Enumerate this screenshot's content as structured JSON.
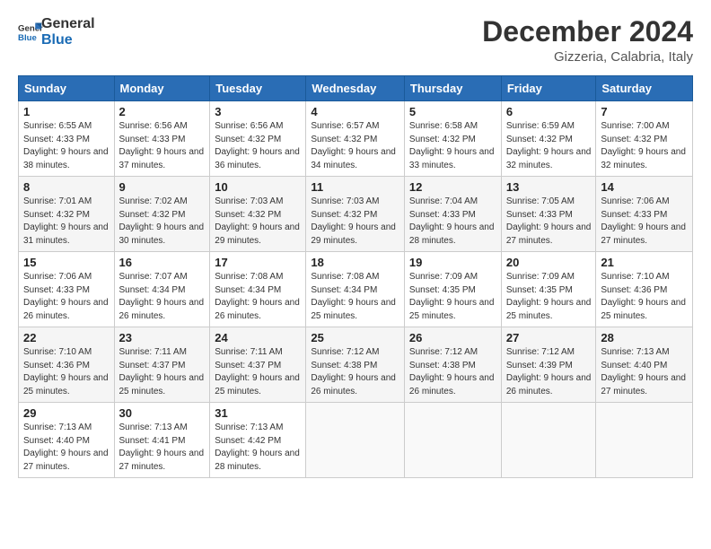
{
  "logo": {
    "line1": "General",
    "line2": "Blue"
  },
  "title": "December 2024",
  "location": "Gizzeria, Calabria, Italy",
  "days_of_week": [
    "Sunday",
    "Monday",
    "Tuesday",
    "Wednesday",
    "Thursday",
    "Friday",
    "Saturday"
  ],
  "weeks": [
    [
      {
        "day": "1",
        "sunrise": "6:55 AM",
        "sunset": "4:33 PM",
        "daylight": "9 hours and 38 minutes."
      },
      {
        "day": "2",
        "sunrise": "6:56 AM",
        "sunset": "4:33 PM",
        "daylight": "9 hours and 37 minutes."
      },
      {
        "day": "3",
        "sunrise": "6:56 AM",
        "sunset": "4:32 PM",
        "daylight": "9 hours and 36 minutes."
      },
      {
        "day": "4",
        "sunrise": "6:57 AM",
        "sunset": "4:32 PM",
        "daylight": "9 hours and 34 minutes."
      },
      {
        "day": "5",
        "sunrise": "6:58 AM",
        "sunset": "4:32 PM",
        "daylight": "9 hours and 33 minutes."
      },
      {
        "day": "6",
        "sunrise": "6:59 AM",
        "sunset": "4:32 PM",
        "daylight": "9 hours and 32 minutes."
      },
      {
        "day": "7",
        "sunrise": "7:00 AM",
        "sunset": "4:32 PM",
        "daylight": "9 hours and 32 minutes."
      }
    ],
    [
      {
        "day": "8",
        "sunrise": "7:01 AM",
        "sunset": "4:32 PM",
        "daylight": "9 hours and 31 minutes."
      },
      {
        "day": "9",
        "sunrise": "7:02 AM",
        "sunset": "4:32 PM",
        "daylight": "9 hours and 30 minutes."
      },
      {
        "day": "10",
        "sunrise": "7:03 AM",
        "sunset": "4:32 PM",
        "daylight": "9 hours and 29 minutes."
      },
      {
        "day": "11",
        "sunrise": "7:03 AM",
        "sunset": "4:32 PM",
        "daylight": "9 hours and 29 minutes."
      },
      {
        "day": "12",
        "sunrise": "7:04 AM",
        "sunset": "4:33 PM",
        "daylight": "9 hours and 28 minutes."
      },
      {
        "day": "13",
        "sunrise": "7:05 AM",
        "sunset": "4:33 PM",
        "daylight": "9 hours and 27 minutes."
      },
      {
        "day": "14",
        "sunrise": "7:06 AM",
        "sunset": "4:33 PM",
        "daylight": "9 hours and 27 minutes."
      }
    ],
    [
      {
        "day": "15",
        "sunrise": "7:06 AM",
        "sunset": "4:33 PM",
        "daylight": "9 hours and 26 minutes."
      },
      {
        "day": "16",
        "sunrise": "7:07 AM",
        "sunset": "4:34 PM",
        "daylight": "9 hours and 26 minutes."
      },
      {
        "day": "17",
        "sunrise": "7:08 AM",
        "sunset": "4:34 PM",
        "daylight": "9 hours and 26 minutes."
      },
      {
        "day": "18",
        "sunrise": "7:08 AM",
        "sunset": "4:34 PM",
        "daylight": "9 hours and 25 minutes."
      },
      {
        "day": "19",
        "sunrise": "7:09 AM",
        "sunset": "4:35 PM",
        "daylight": "9 hours and 25 minutes."
      },
      {
        "day": "20",
        "sunrise": "7:09 AM",
        "sunset": "4:35 PM",
        "daylight": "9 hours and 25 minutes."
      },
      {
        "day": "21",
        "sunrise": "7:10 AM",
        "sunset": "4:36 PM",
        "daylight": "9 hours and 25 minutes."
      }
    ],
    [
      {
        "day": "22",
        "sunrise": "7:10 AM",
        "sunset": "4:36 PM",
        "daylight": "9 hours and 25 minutes."
      },
      {
        "day": "23",
        "sunrise": "7:11 AM",
        "sunset": "4:37 PM",
        "daylight": "9 hours and 25 minutes."
      },
      {
        "day": "24",
        "sunrise": "7:11 AM",
        "sunset": "4:37 PM",
        "daylight": "9 hours and 25 minutes."
      },
      {
        "day": "25",
        "sunrise": "7:12 AM",
        "sunset": "4:38 PM",
        "daylight": "9 hours and 26 minutes."
      },
      {
        "day": "26",
        "sunrise": "7:12 AM",
        "sunset": "4:38 PM",
        "daylight": "9 hours and 26 minutes."
      },
      {
        "day": "27",
        "sunrise": "7:12 AM",
        "sunset": "4:39 PM",
        "daylight": "9 hours and 26 minutes."
      },
      {
        "day": "28",
        "sunrise": "7:13 AM",
        "sunset": "4:40 PM",
        "daylight": "9 hours and 27 minutes."
      }
    ],
    [
      {
        "day": "29",
        "sunrise": "7:13 AM",
        "sunset": "4:40 PM",
        "daylight": "9 hours and 27 minutes."
      },
      {
        "day": "30",
        "sunrise": "7:13 AM",
        "sunset": "4:41 PM",
        "daylight": "9 hours and 27 minutes."
      },
      {
        "day": "31",
        "sunrise": "7:13 AM",
        "sunset": "4:42 PM",
        "daylight": "9 hours and 28 minutes."
      },
      null,
      null,
      null,
      null
    ]
  ]
}
